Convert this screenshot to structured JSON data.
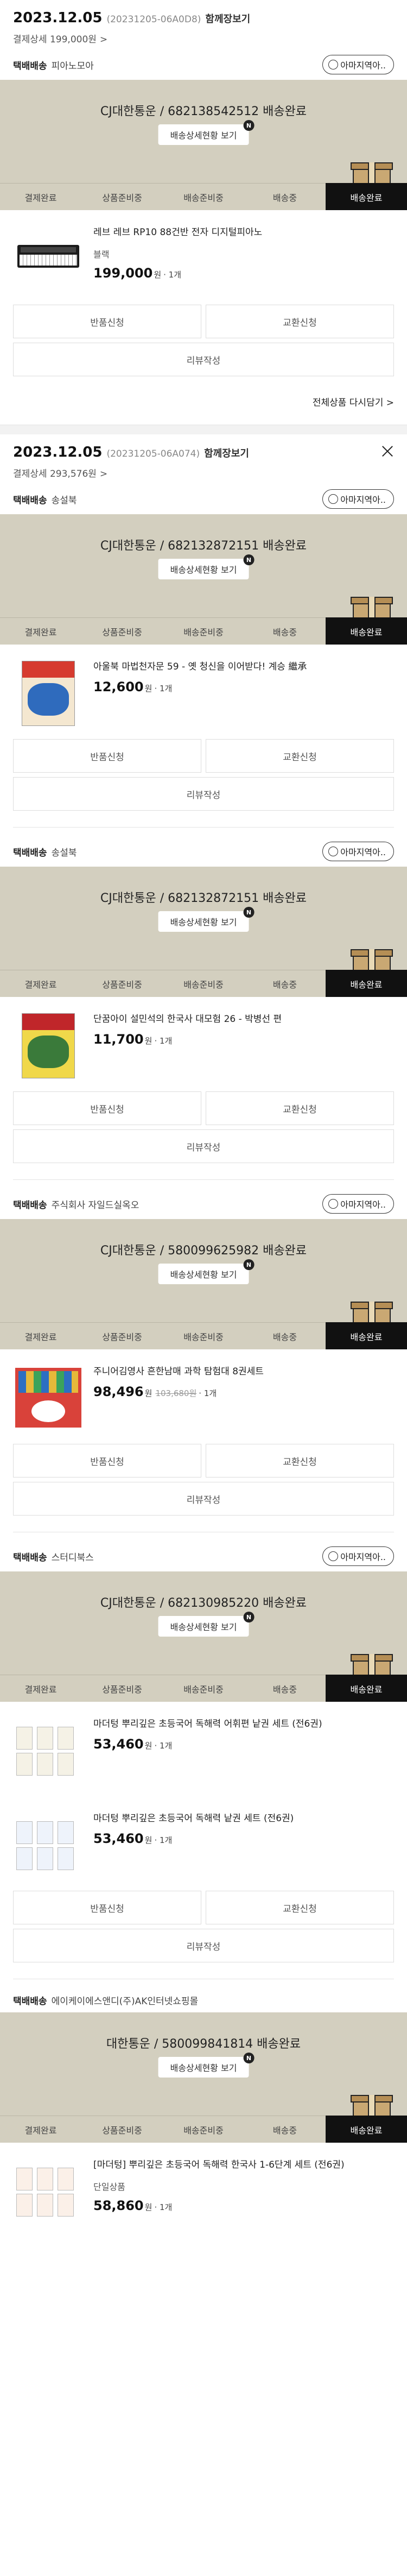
{
  "colors": {
    "banner_bg": "#d3cfbf",
    "active_step_bg": "#111111",
    "box_tan": "#c9a873"
  },
  "icons": {
    "close": "close-icon",
    "chevron": "chevron-right-icon",
    "inquiry": "headset-icon",
    "badge": "n-badge",
    "box": "delivery-box-icon"
  },
  "labels": {
    "chev": ">",
    "close": "×",
    "inquiry": "아마지역아..",
    "track": "배송상세현황 보기",
    "badge": "N",
    "won": "원",
    "qty": "· 1개",
    "return": "반품신청",
    "exchange": "교환신청",
    "review": "리뷰작성",
    "ship_type": "택배배송"
  },
  "steps": [
    "결제완료",
    "상품준비중",
    "배송준비중",
    "배송중",
    "배송완료"
  ],
  "orders": [
    {
      "date": "2023.12.05",
      "order_no": "(20231205-06A0D8)",
      "combined": "함께장보기",
      "pay_detail": "결제상세 199,000원",
      "reorder": "전체상품 다시담기 >",
      "shipments": [
        {
          "seller": "피아노모아",
          "carrier": "CJ대한통운 / 682138542512 배송완료",
          "products": [
            {
              "name": "레브 레브 RP10 88건반 전자 디지털피아노",
              "option": "블랙",
              "price": "199,000",
              "orig": "",
              "thumb": "piano"
            }
          ],
          "actions": [
            "return",
            "exchange",
            "review"
          ]
        }
      ]
    },
    {
      "date": "2023.12.05",
      "order_no": "(20231205-06A074)",
      "combined": "함께장보기",
      "pay_detail": "결제상세 293,576원",
      "shipments": [
        {
          "seller": "송설북",
          "carrier": "CJ대한통운 / 682132872151 배송완료",
          "products": [
            {
              "name": "아울북 마법천자문 59 - 옛 청신을 이어받다! 계승 繼承",
              "option": "",
              "price": "12,600",
              "orig": "",
              "thumb": "book-red"
            }
          ],
          "actions": [
            "return",
            "exchange",
            "review"
          ]
        },
        {
          "seller": "송설북",
          "carrier": "CJ대한통운 / 682132872151 배송완료",
          "products": [
            {
              "name": "단꿈아이 설민석의 한국사 대모험 26 - 박병선 편",
              "option": "",
              "price": "11,700",
              "orig": "",
              "thumb": "book-yellow"
            }
          ],
          "actions": [
            "return",
            "exchange",
            "review"
          ]
        },
        {
          "seller": "주식회사 자일드실옥오",
          "carrier": "CJ대한통운 / 580099625982 배송완료",
          "products": [
            {
              "name": "주니어김영사 흔한남매 과학 탐험대 8권세트",
              "option": "",
              "price": "98,496",
              "orig": "103,680원",
              "thumb": "set-red"
            }
          ],
          "actions": [
            "return",
            "exchange",
            "review"
          ]
        },
        {
          "seller": "스터디북스",
          "carrier": "CJ대한통운 / 682130985220 배송완료",
          "products": [
            {
              "name": "마더텅 뿌리깊은 초등국어 독해력 어휘편 낱권 세트 (전6권)",
              "option": "",
              "price": "53,460",
              "orig": "",
              "thumb": "mini-set"
            },
            {
              "name": "마더텅 뿌리깊은 초등국어 독해력 낱권 세트 (전6권)",
              "option": "",
              "price": "53,460",
              "orig": "",
              "thumb": "mini-set2"
            }
          ],
          "actions": [
            "return",
            "exchange",
            "review"
          ]
        },
        {
          "seller": "에이케이에스앤디(주)AK인터넷쇼핑몰",
          "carrier": "대한통운 / 580099841814 배송완료",
          "products": [
            {
              "name": "[마더텅] 뿌리깊은 초등국어 독해력 한국사 1-6단계 세트 (전6권)",
              "option": "단일상품",
              "price": "58,860",
              "orig": "",
              "thumb": "mini-set3"
            }
          ],
          "actions": []
        }
      ]
    }
  ]
}
